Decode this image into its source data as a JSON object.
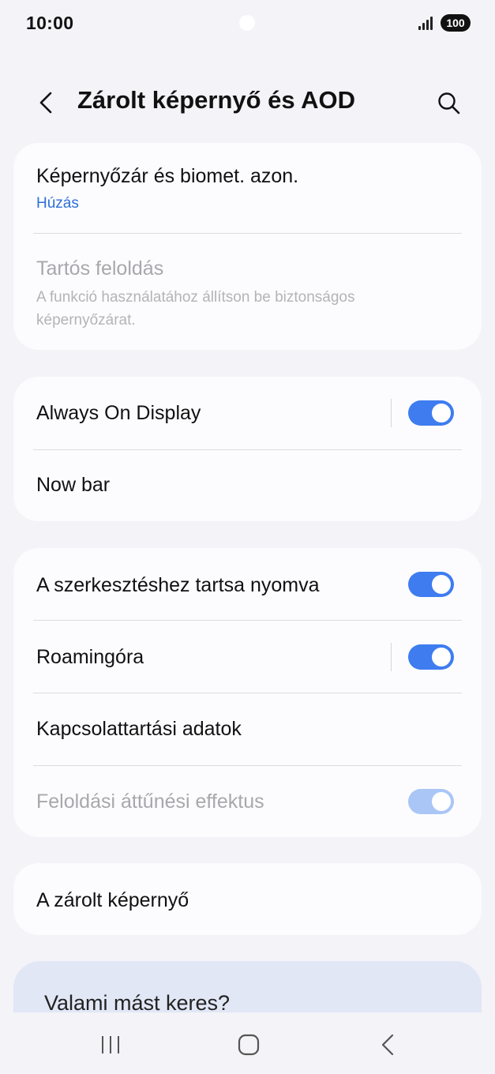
{
  "status_bar": {
    "time": "10:00",
    "battery": "100"
  },
  "header": {
    "title": "Zárolt képernyő és AOD"
  },
  "card1": {
    "screen_lock": {
      "title": "Képernyőzár és biomet. azon.",
      "value": "Húzás"
    },
    "extend_unlock": {
      "title": "Tartós feloldás",
      "description": "A funkció használatához állítson be biztonságos képernyőzárat."
    }
  },
  "card2": {
    "aod": {
      "title": "Always On Display",
      "enabled": true
    },
    "now_bar": {
      "title": "Now bar"
    }
  },
  "card3": {
    "edit_hold": {
      "title": "A szerkesztéshez tartsa nyomva",
      "enabled": true
    },
    "roaming_clock": {
      "title": "Roamingóra",
      "enabled": true
    },
    "contact_info": {
      "title": "Kapcsolattartási adatok"
    },
    "unlock_fade": {
      "title": "Feloldási áttűnési effektus",
      "enabled": true
    }
  },
  "card4": {
    "about": {
      "title": "A zárolt képernyő"
    }
  },
  "suggestion": {
    "text": "Valami mást keres?"
  },
  "colors": {
    "accent": "#3e7cf0",
    "link": "#2d6fd8",
    "background": "#f3f3f8",
    "card": "#fcfcff"
  }
}
